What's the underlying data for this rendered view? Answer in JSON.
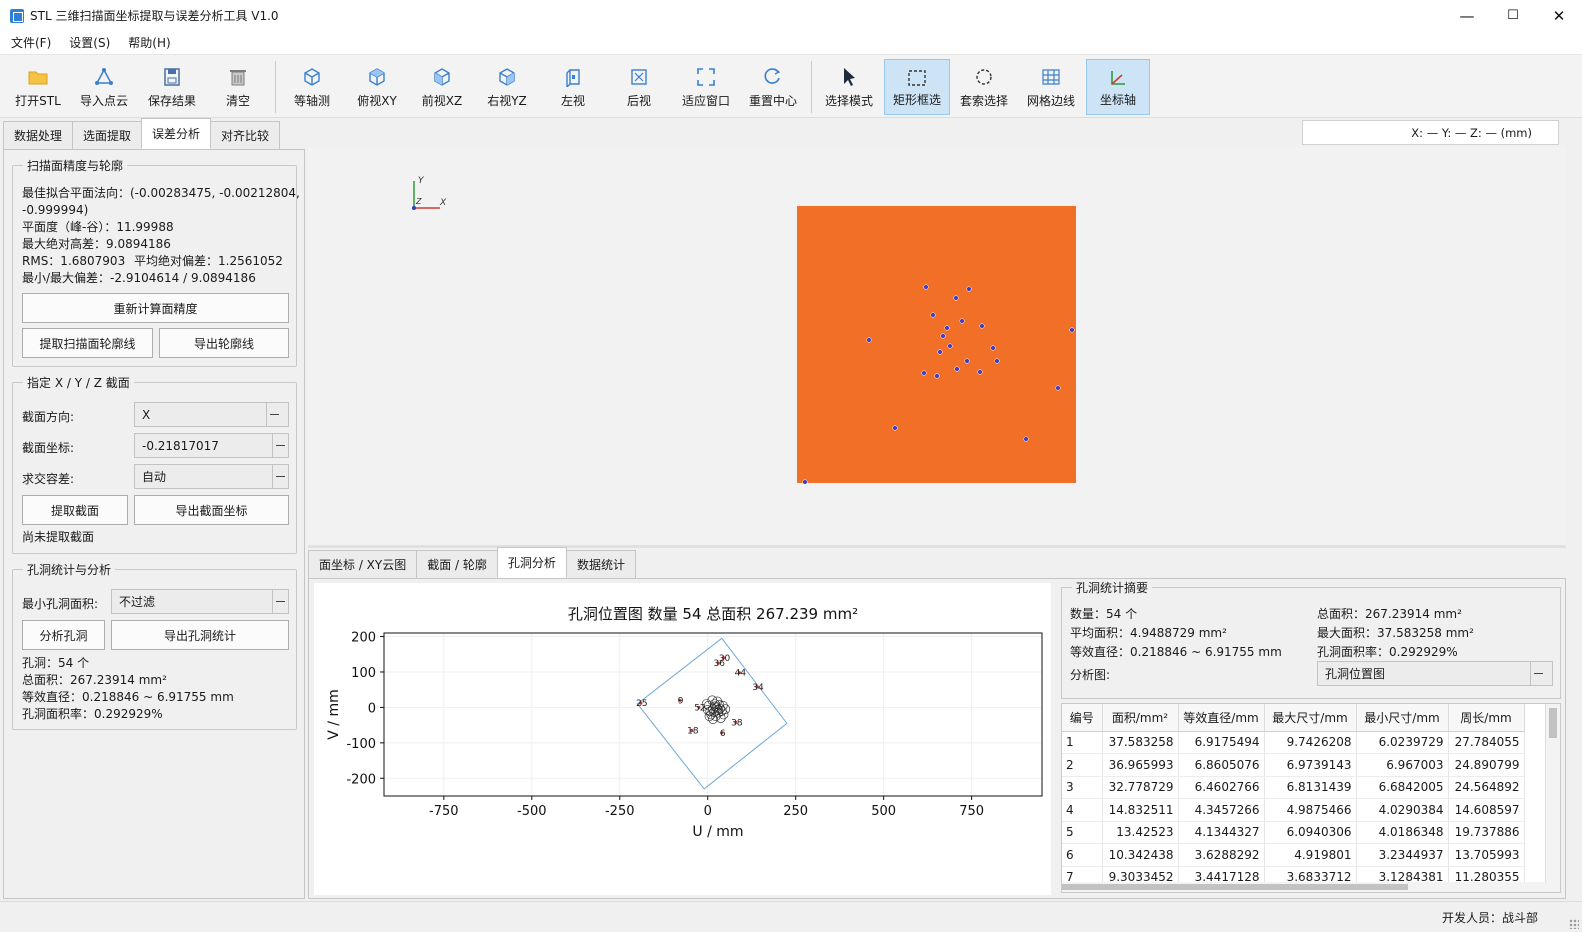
{
  "window": {
    "title": "STL 三维扫描面坐标提取与误差分析工具 V1.0",
    "minimize": "—",
    "maximize": "☐",
    "close": "✕"
  },
  "menu": [
    "文件(F)",
    "设置(S)",
    "帮助(H)"
  ],
  "toolbar": [
    {
      "label": "打开STL",
      "icon": "folder-icon",
      "active": false
    },
    {
      "label": "导入点云",
      "icon": "points-icon",
      "active": false
    },
    {
      "label": "保存结果",
      "icon": "save-icon",
      "active": false
    },
    {
      "label": "清空",
      "icon": "trash-icon",
      "active": false
    },
    {
      "label": "等轴测",
      "icon": "cube-iso-icon",
      "active": false
    },
    {
      "label": "俯视XY",
      "icon": "cube-top-icon",
      "active": false
    },
    {
      "label": "前视XZ",
      "icon": "cube-front-icon",
      "active": false
    },
    {
      "label": "右视YZ",
      "icon": "cube-right-icon",
      "active": false
    },
    {
      "label": "左视",
      "icon": "left-view-icon",
      "active": false
    },
    {
      "label": "后视",
      "icon": "back-view-icon",
      "active": false
    },
    {
      "label": "适应窗口",
      "icon": "fit-window-icon",
      "active": false
    },
    {
      "label": "重置中心",
      "icon": "reset-center-icon",
      "active": false
    },
    {
      "label": "选择模式",
      "icon": "cursor-icon",
      "active": false
    },
    {
      "label": "矩形框选",
      "icon": "rect-select-icon",
      "active": true
    },
    {
      "label": "套索选择",
      "icon": "lasso-icon",
      "active": false
    },
    {
      "label": "网格边线",
      "icon": "grid-icon",
      "active": false
    },
    {
      "label": "坐标轴",
      "icon": "axes-icon",
      "active": true
    }
  ],
  "left_tabs": [
    "数据处理",
    "选面提取",
    "误差分析",
    "对齐比较"
  ],
  "left_selected_tab": "误差分析",
  "precision": {
    "title": "扫描面精度与轮廓",
    "normal_line1": "最佳拟合平面法向：(-0.00283475, -0.00212804,",
    "normal_line2": "-0.999994)",
    "flatness": "平面度（峰-谷）：11.99988",
    "max_height": "最大绝对高差：9.0894186",
    "rms": "RMS：1.6807903",
    "mean_dev": "平均绝对偏差：1.2561052",
    "minmax": "最小/最大偏差：-2.9104614 / 9.0894186",
    "recalc_button": "重新计算面精度",
    "extract_contour_button": "提取扫描面轮廓线",
    "export_contour_button": "导出轮廓线"
  },
  "section": {
    "title": "指定 X / Y / Z 截面",
    "direction_label": "截面方向:",
    "direction_value": "X",
    "coord_label": "截面坐标:",
    "coord_value": "-0.21817017",
    "tolerance_label": "求交容差:",
    "tolerance_value": "自动",
    "extract_button": "提取截面",
    "export_button": "导出截面坐标",
    "status": "尚未提取截面"
  },
  "holes": {
    "title": "孔洞统计与分析",
    "min_area_label": "最小孔洞面积:",
    "min_area_value": "不过滤",
    "analyze_button": "分析孔洞",
    "export_button": "导出孔洞统计",
    "count": "孔洞：54 个",
    "total_area": "总面积：267.23914 mm²",
    "diameter": "等效直径：0.218846 ~ 6.91755 mm",
    "ratio": "孔洞面积率：0.292929%"
  },
  "coord_readout": "X: —    Y: —    Z: —     (mm)",
  "viewport": {
    "axis_x": "X",
    "axis_y": "Y",
    "axis_z": "Z",
    "surface_color": "#f26f28",
    "hole_color": "#3a3ec9"
  },
  "bottom_tabs": [
    "面坐标 / XY云图",
    "截面 / 轮廓",
    "孔洞分析",
    "数据统计"
  ],
  "bottom_selected_tab": "孔洞分析",
  "chart_data": {
    "type": "scatter",
    "title": "孔洞位置图  数量 54  总面积 267.239 mm²",
    "xlabel": "U / mm",
    "ylabel": "V / mm",
    "xlim": [
      -920,
      950
    ],
    "ylim": [
      -250,
      210
    ],
    "xticks": [
      -750,
      -500,
      -250,
      0,
      250,
      500,
      750
    ],
    "yticks": [
      200,
      100,
      0,
      -100,
      -200
    ],
    "boundary": [
      [
        -200,
        10
      ],
      [
        -10,
        -230
      ],
      [
        225,
        -45
      ],
      [
        40,
        195
      ]
    ],
    "labeled_holes": [
      {
        "label": "25",
        "u": -190,
        "v": 12
      },
      {
        "label": "9",
        "u": -80,
        "v": 20
      },
      {
        "label": "18",
        "u": -45,
        "v": -65
      },
      {
        "label": "30",
        "u": 45,
        "v": 140
      },
      {
        "label": "36",
        "u": 30,
        "v": 125
      },
      {
        "label": "44",
        "u": 90,
        "v": 98
      },
      {
        "label": "34",
        "u": 140,
        "v": 58
      },
      {
        "label": "52",
        "u": -25,
        "v": 0
      },
      {
        "label": "38",
        "u": 80,
        "v": -42
      },
      {
        "label": "6",
        "u": 40,
        "v": -72
      }
    ]
  },
  "summary": {
    "title": "孔洞统计摘要",
    "count": "数量：54 个",
    "total_area": "总面积：267.23914 mm²",
    "avg_area": "平均面积：4.9488729 mm²",
    "max_area": "最大面积：37.583258 mm²",
    "diameter": "等效直径：0.218846 ~ 6.91755 mm",
    "ratio": "孔洞面积率：0.292929%",
    "chart_label": "分析图:",
    "chart_value": "孔洞位置图"
  },
  "table": {
    "headers": [
      "编号",
      "面积/mm²",
      "等效直径/mm",
      "最大尺寸/mm",
      "最小尺寸/mm",
      "周长/mm"
    ],
    "rows": [
      [
        "1",
        "37.583258",
        "6.9175494",
        "9.7426208",
        "6.0239729",
        "27.784055"
      ],
      [
        "2",
        "36.965993",
        "6.8605076",
        "6.9739143",
        "6.967003",
        "24.890799"
      ],
      [
        "3",
        "32.778729",
        "6.4602766",
        "6.8131439",
        "6.6842005",
        "24.564892"
      ],
      [
        "4",
        "14.832511",
        "4.3457266",
        "4.9875466",
        "4.0290384",
        "14.608597"
      ],
      [
        "5",
        "13.42523",
        "4.1344327",
        "6.0940306",
        "4.0186348",
        "19.737886"
      ],
      [
        "6",
        "10.342438",
        "3.6288292",
        "4.919801",
        "3.2344937",
        "13.705993"
      ],
      [
        "7",
        "9.3033452",
        "3.4417128",
        "3.6833712",
        "3.1284381",
        "11.280355"
      ]
    ]
  },
  "status": "开发人员：战斗部"
}
